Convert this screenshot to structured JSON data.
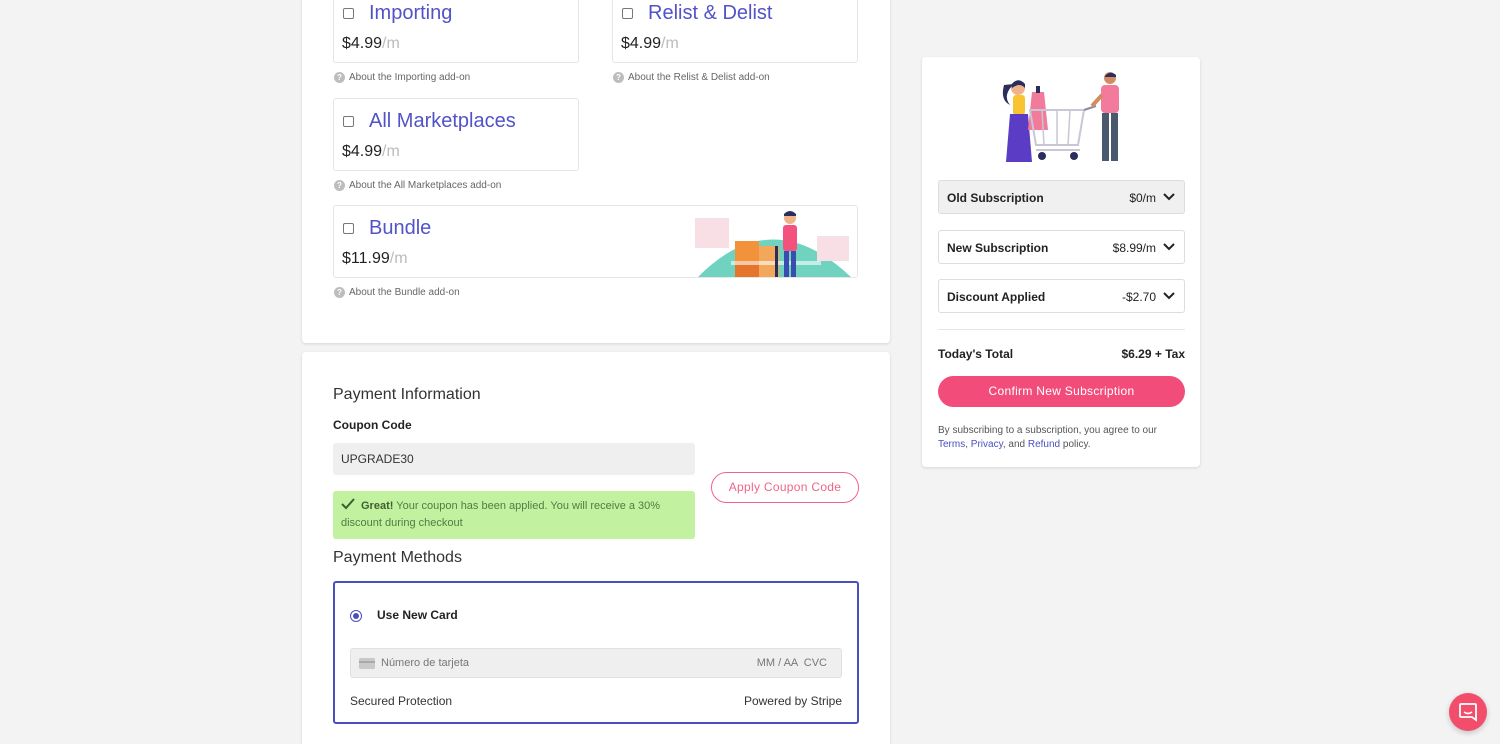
{
  "addons": {
    "items": [
      {
        "name": "Importing",
        "price": "$4.99",
        "per": "/m",
        "about": "About the Importing add-on"
      },
      {
        "name": "Relist & Delist",
        "price": "$4.99",
        "per": "/m",
        "about": "About the Relist & Delist add-on"
      },
      {
        "name": "All Marketplaces",
        "price": "$4.99",
        "per": "/m",
        "about": "About the All Marketplaces add-on"
      },
      {
        "name": "Bundle",
        "price": "$11.99",
        "per": "/m",
        "about": "About the Bundle add-on"
      }
    ]
  },
  "payment": {
    "title": "Payment Information",
    "coupon_label": "Coupon Code",
    "coupon_value": "UPGRADE30",
    "apply_label": "Apply Coupon Code",
    "success_bold": "Great!",
    "success_text": " Your coupon has been applied. You will receive a 30% discount during checkout",
    "methods_title": "Payment Methods",
    "new_card_label": "Use New Card",
    "card_placeholder": "Número de tarjeta",
    "card_expiry_cvc": "MM / AA  CVC",
    "secured": "Secured Protection",
    "powered": "Powered by Stripe"
  },
  "summary": {
    "rows": [
      {
        "label": "Old Subscription",
        "value": "$0/m"
      },
      {
        "label": "New Subscription",
        "value": "$8.99/m"
      },
      {
        "label": "Discount Applied",
        "value": "-$2.70"
      }
    ],
    "total_label": "Today's Total",
    "total_value": "$6.29 + Tax",
    "confirm_label": "Confirm New Subscription",
    "terms_prefix": "By subscribing to a subscription, you agree to our ",
    "terms_link": "Terms",
    "terms_sep": ",",
    "privacy_link": "Privacy",
    "terms_and": ", and ",
    "refund_link": "Refund",
    "terms_suffix": " policy."
  },
  "colors": {
    "accent": "#5252c9",
    "pink": "#f24d7a",
    "success_bg": "#c2f2a0"
  },
  "icons": {
    "help": "question-circle-icon",
    "check": "check-icon",
    "chevron": "chevron-down-icon",
    "chat": "chat-bubble-icon",
    "card": "credit-card-icon"
  }
}
